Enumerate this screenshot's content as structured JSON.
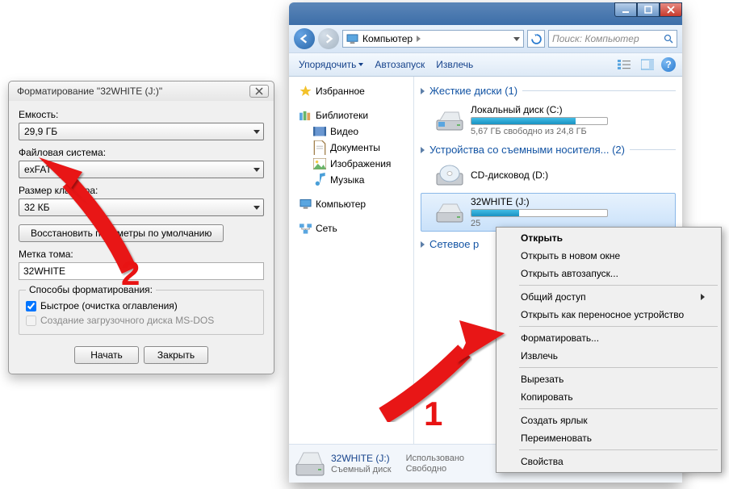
{
  "format_dialog": {
    "title": "Форматирование \"32WHITE (J:)\"",
    "labels": {
      "capacity": "Емкость:",
      "filesystem": "Файловая система:",
      "cluster": "Размер кластера:",
      "volume_label": "Метка тома:",
      "methods": "Способы форматирования:"
    },
    "values": {
      "capacity": "29,9 ГБ",
      "filesystem": "exFAT",
      "cluster": "32 КБ",
      "volume_label": "32WHITE"
    },
    "buttons": {
      "restore": "Восстановить параметры по умолчанию",
      "start": "Начать",
      "close": "Закрыть"
    },
    "checks": {
      "quick": "Быстрое (очистка оглавления)",
      "msdos": "Создание загрузочного диска MS-DOS"
    }
  },
  "explorer": {
    "breadcrumb": "Компьютер",
    "search_placeholder": "Поиск: Компьютер",
    "toolbar": {
      "organize": "Упорядочить",
      "autorun": "Автозапуск",
      "eject": "Извлечь"
    },
    "nav": {
      "favorites": "Избранное",
      "libraries": "Библиотеки",
      "video": "Видео",
      "documents": "Документы",
      "images": "Изображения",
      "music": "Музыка",
      "computer": "Компьютер",
      "network": "Сеть"
    },
    "groups": {
      "hdd": "Жесткие диски (1)",
      "removable": "Устройства со съемными носителя... (2)",
      "netloc": "Сетевое р"
    },
    "drives": {
      "c": {
        "title": "Локальный диск (C:)",
        "sub": "5,67 ГБ свободно из 24,8 ГБ",
        "fill_pct": 77
      },
      "cd": {
        "title": "CD-дисковод (D:)"
      },
      "j": {
        "title": "32WHITE (J:)",
        "sub": "25"
      }
    },
    "status": {
      "name": "32WHITE (J:)",
      "type": "Съемный диск",
      "used_label": "Использовано",
      "free_label": "Свободно"
    }
  },
  "context_menu": {
    "open": "Открыть",
    "open_new": "Открыть в новом окне",
    "autorun": "Открыть автозапуск...",
    "share": "Общий доступ",
    "portable": "Открыть как переносное устройство",
    "format": "Форматировать...",
    "eject": "Извлечь",
    "cut": "Вырезать",
    "copy": "Копировать",
    "shortcut": "Создать ярлык",
    "rename": "Переименовать",
    "properties": "Свойства"
  },
  "annotations": {
    "one": "1",
    "two": "2"
  }
}
